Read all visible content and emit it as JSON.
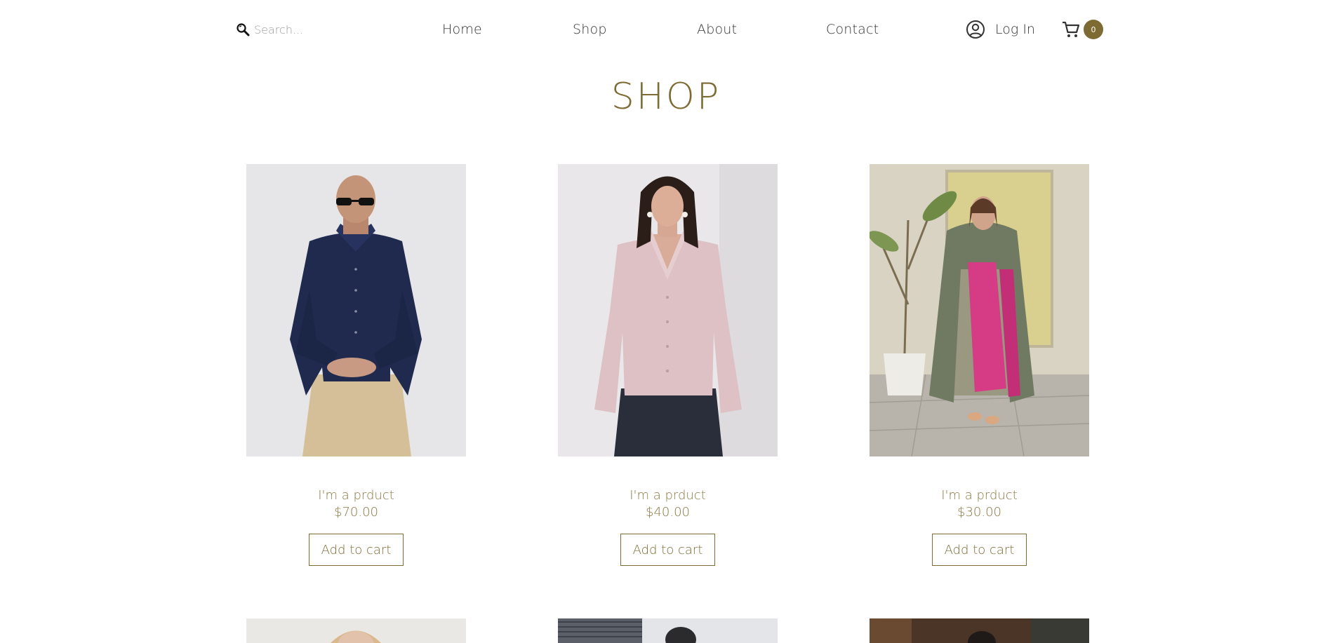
{
  "header": {
    "search": {
      "placeholder": "Search...",
      "value": ""
    },
    "nav": [
      {
        "label": "Home"
      },
      {
        "label": "Shop"
      },
      {
        "label": "About"
      },
      {
        "label": "Contact"
      }
    ],
    "login_label": "Log In",
    "cart_count": "0"
  },
  "page": {
    "title": "SHOP"
  },
  "products": [
    {
      "name": "I'm a prduct",
      "price": "$70.00",
      "button_label": "Add to cart"
    },
    {
      "name": "I'm a prduct",
      "price": "$40.00",
      "button_label": "Add to cart"
    },
    {
      "name": "I'm a prduct",
      "price": "$30.00",
      "button_label": "Add to cart"
    }
  ],
  "theme": {
    "accent": "#7d6b33",
    "text": "#333333"
  }
}
